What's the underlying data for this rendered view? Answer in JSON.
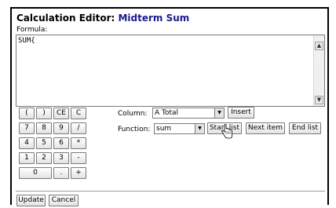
{
  "dialog": {
    "title_prefix": "Calculation Editor:",
    "title_name": "Midterm Sum",
    "formula_label": "Formula:",
    "formula_value": "SUM{"
  },
  "keypad": {
    "row1": [
      "(",
      ")",
      "CE",
      "C"
    ],
    "row2": [
      "7",
      "8",
      "9",
      "/"
    ],
    "row3": [
      "4",
      "5",
      "6",
      "*"
    ],
    "row4": [
      "1",
      "2",
      "3",
      "-"
    ],
    "row5": [
      "0",
      ".",
      "+"
    ]
  },
  "column": {
    "label": "Column:",
    "selected": "A Total",
    "insert_label": "Insert"
  },
  "function": {
    "label": "Function:",
    "selected": "sum",
    "start_list_label": "Start list",
    "next_item_label": "Next item",
    "end_list_label": "End list"
  },
  "footer": {
    "update_label": "Update",
    "cancel_label": "Cancel"
  }
}
